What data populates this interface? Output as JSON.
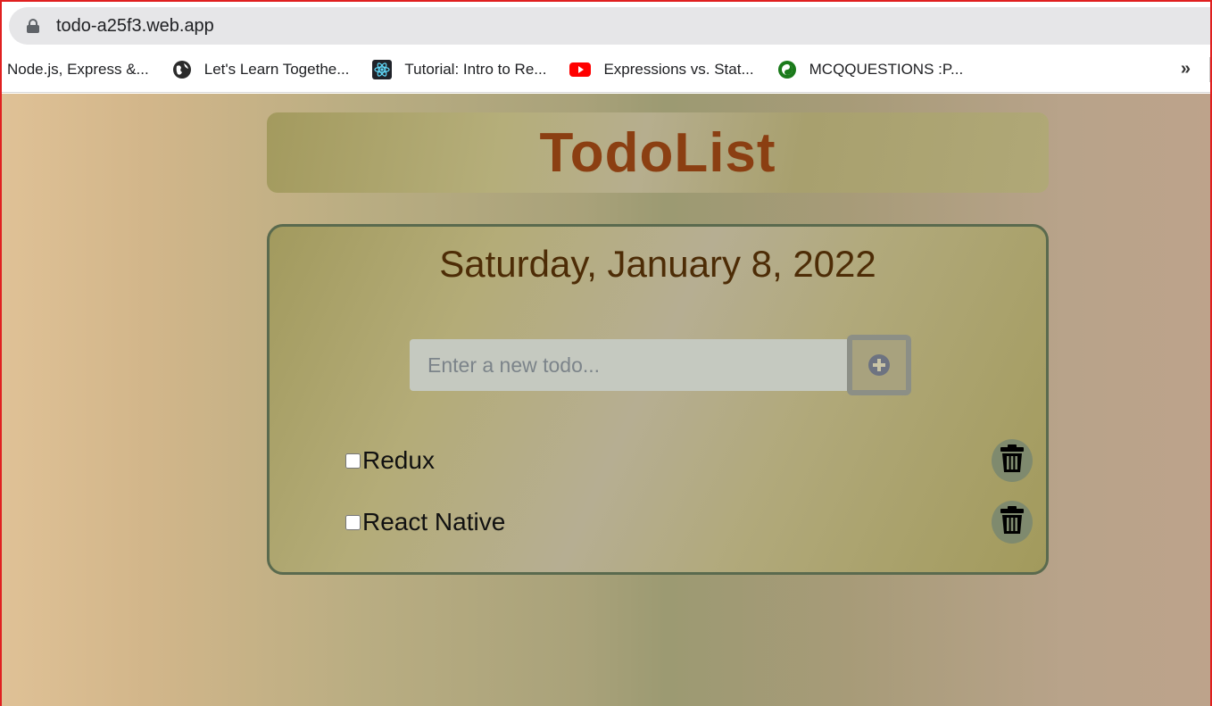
{
  "browser": {
    "url": "todo-a25f3.web.app",
    "bookmarks": [
      {
        "label": "Node.js, Express &...",
        "icon": "none"
      },
      {
        "label": "Let's Learn Togethe...",
        "icon": "globe-icon"
      },
      {
        "label": "Tutorial: Intro to Re...",
        "icon": "react-icon"
      },
      {
        "label": "Expressions vs. Stat...",
        "icon": "youtube-icon"
      },
      {
        "label": "MCQQUESTIONS :P...",
        "icon": "mcq-icon"
      }
    ],
    "more": "»"
  },
  "app": {
    "title": "TodoList",
    "date": "Saturday, January 8, 2022",
    "input": {
      "placeholder": "Enter a new todo...",
      "value": ""
    },
    "todos": [
      {
        "text": "Redux",
        "done": false
      },
      {
        "text": "React Native",
        "done": false
      }
    ]
  },
  "colors": {
    "title": "#8b3f12",
    "date": "#4d2c06",
    "card_border": "#5a6a4e",
    "delete_button": "#7f8a6e"
  }
}
